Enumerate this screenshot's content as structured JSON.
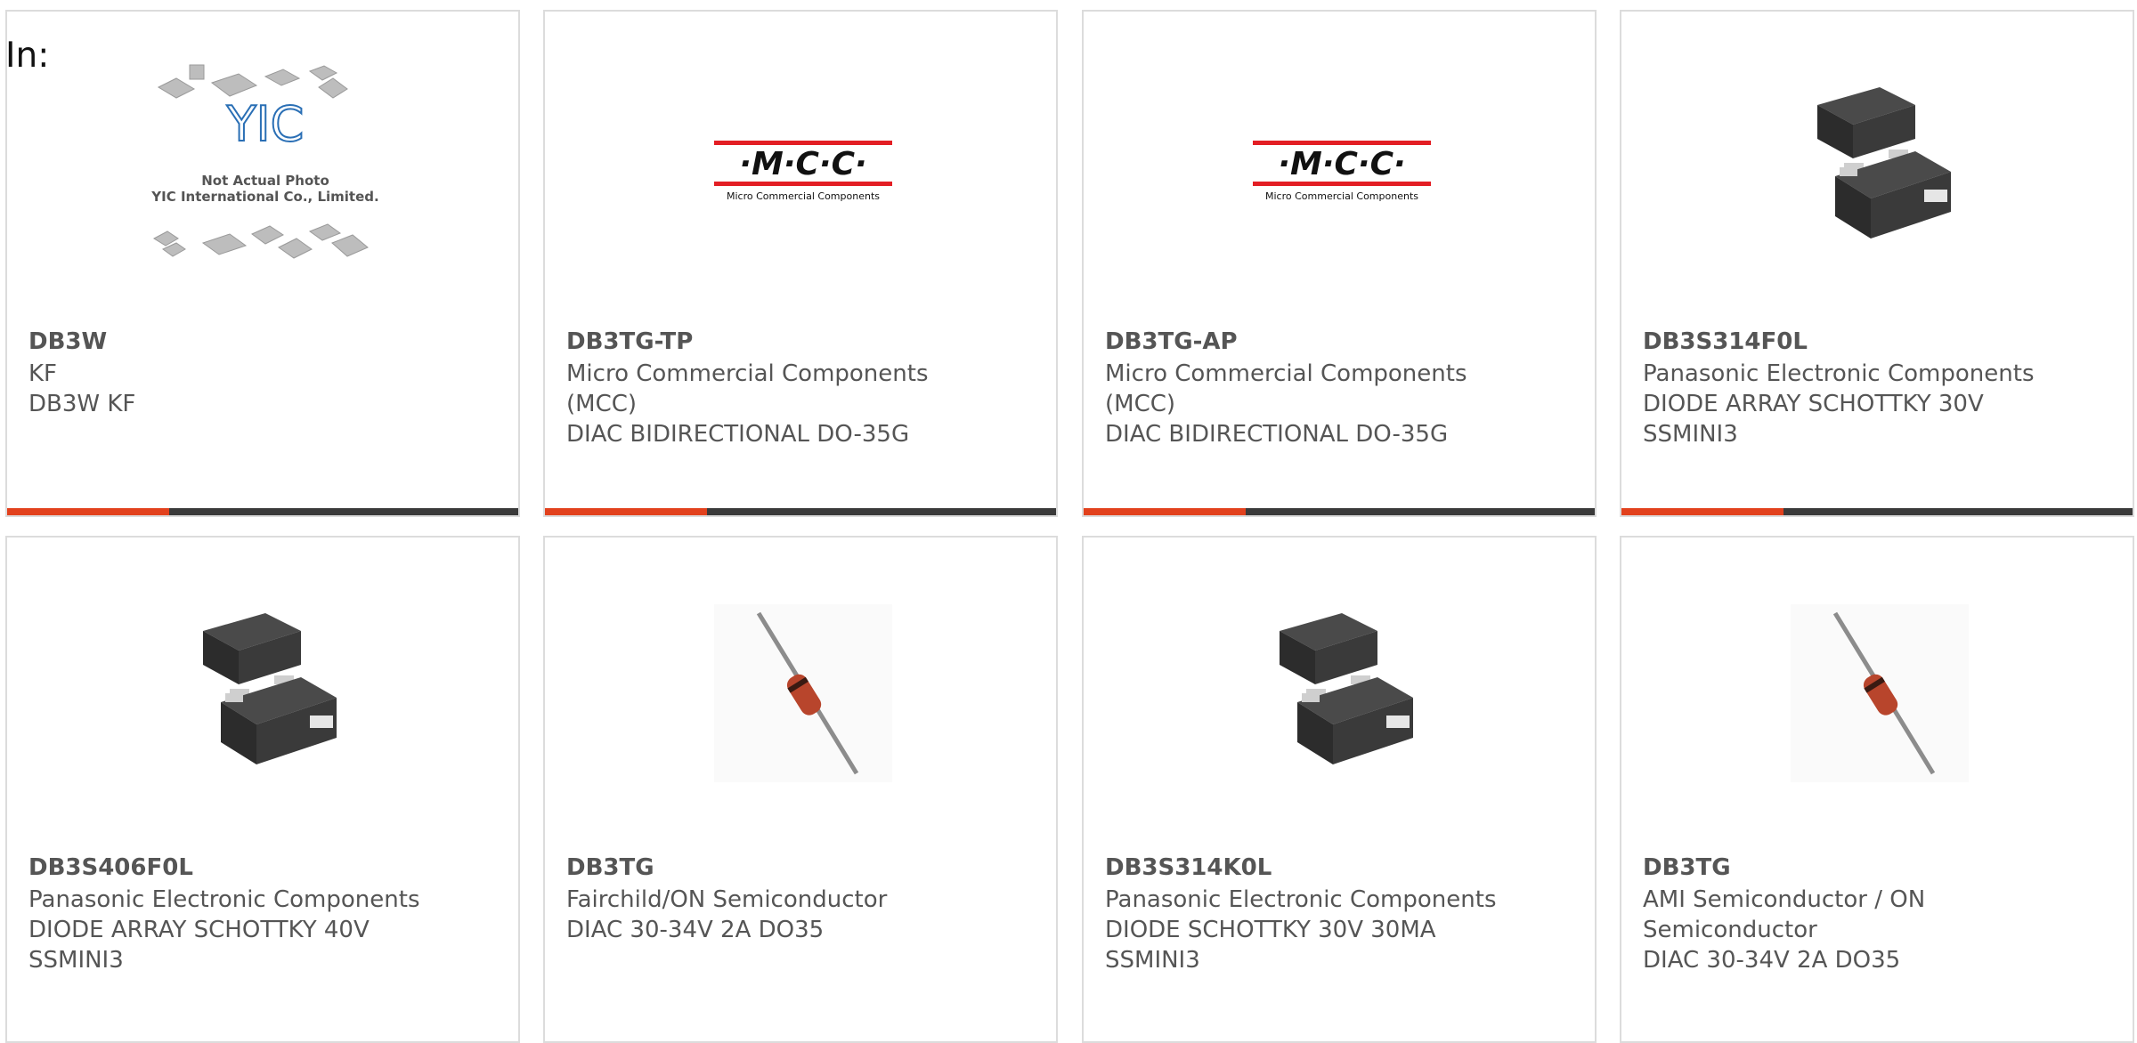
{
  "filter_label": "In:",
  "products": [
    {
      "part": "DB3W",
      "manufacturer": "KF",
      "description": "DB3W KF",
      "image": "not-actual-photo",
      "image_caption_1": "Not Actual Photo",
      "image_caption_2": "YIC International Co., Limited.",
      "image_logo": "YIC"
    },
    {
      "part": "DB3TG-TP",
      "manufacturer": "Micro Commercial Components (MCC)",
      "description": "DIAC BIDIRECTIONAL DO-35G",
      "image": "mcc-logo",
      "logo_text": "·M·C·C·",
      "logo_sub": "Micro Commercial Components"
    },
    {
      "part": "DB3TG-AP",
      "manufacturer": "Micro Commercial Components (MCC)",
      "description": "DIAC BIDIRECTIONAL DO-35G",
      "image": "mcc-logo",
      "logo_text": "·M·C·C·",
      "logo_sub": "Micro Commercial Components"
    },
    {
      "part": "DB3S314F0L",
      "manufacturer": "Panasonic Electronic Components",
      "description": "DIODE ARRAY SCHOTTKY 30V SSMINI3",
      "image": "sot-package"
    },
    {
      "part": "DB3S406F0L",
      "manufacturer": "Panasonic Electronic Components",
      "description": "DIODE ARRAY SCHOTTKY 40V SSMINI3",
      "image": "sot-package"
    },
    {
      "part": "DB3TG",
      "manufacturer": "Fairchild/ON Semiconductor",
      "description": "DIAC 30-34V 2A DO35",
      "image": "axial-diode"
    },
    {
      "part": "DB3S314K0L",
      "manufacturer": "Panasonic Electronic Components",
      "description": "DIODE SCHOTTKY 30V 30MA SSMINI3",
      "image": "sot-package"
    },
    {
      "part": "DB3TG",
      "manufacturer": "AMI Semiconductor / ON Semiconductor",
      "description": "DIAC 30-34V 2A DO35",
      "image": "axial-diode"
    }
  ],
  "colors": {
    "accent": "#e2411d",
    "bar": "#3a3a3a",
    "text": "#555555",
    "border": "#dcdcdc"
  }
}
